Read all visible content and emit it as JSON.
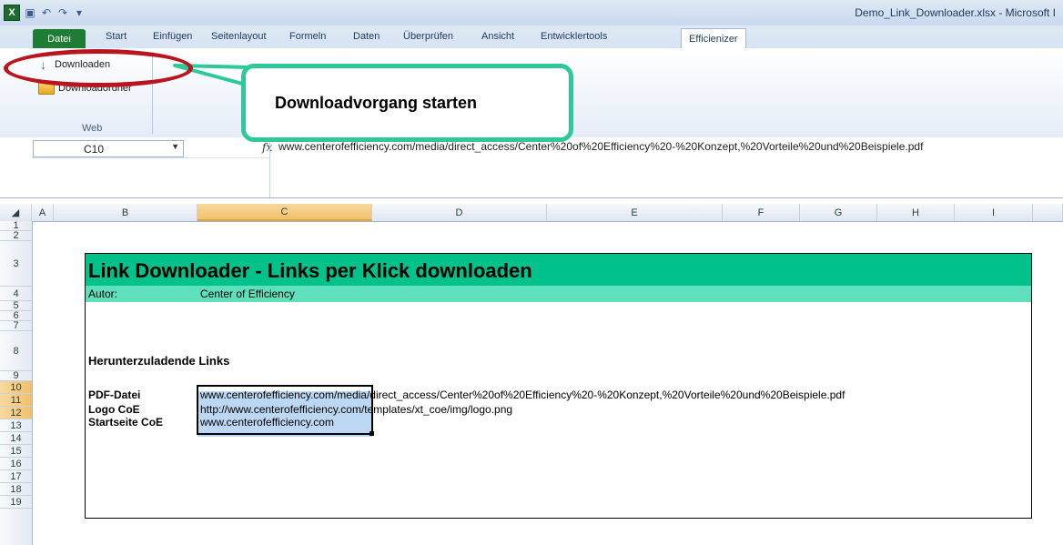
{
  "window": {
    "title": "Demo_Link_Downloader.xlsx - Microsoft I",
    "app_icon": "excel-icon",
    "quick_access": [
      "save-icon",
      "undo-icon",
      "redo-icon",
      "customize-icon"
    ]
  },
  "tabs": [
    {
      "label": "Datei"
    },
    {
      "label": "Start"
    },
    {
      "label": "Einfügen"
    },
    {
      "label": "Seitenlayout"
    },
    {
      "label": "Formeln"
    },
    {
      "label": "Daten"
    },
    {
      "label": "Überprüfen"
    },
    {
      "label": "Ansicht"
    },
    {
      "label": "Entwicklertools"
    },
    {
      "label": "Efficienizer"
    }
  ],
  "ribbon": {
    "downloaden_label": "Downloaden",
    "downloadordner_label": "Downloadordner",
    "group_label": "Web"
  },
  "callout": {
    "text": "Downloadvorgang starten"
  },
  "formula_bar": {
    "name_box": "C10",
    "fx": "fx",
    "formula": "www.centerofefficiency.com/media/direct_access/Center%20of%20Efficiency%20-%20Konzept,%20Vorteile%20und%20Beispiele.pdf"
  },
  "columns": [
    "A",
    "B",
    "C",
    "D",
    "E",
    "F",
    "G",
    "H",
    "I"
  ],
  "rows": [
    "1",
    "2",
    "3",
    "4",
    "5",
    "6",
    "7",
    "8",
    "9",
    "10",
    "11",
    "12",
    "13",
    "14",
    "15",
    "16",
    "17",
    "18",
    "19"
  ],
  "sheet": {
    "title": "Link Downloader - Links per Klick downloaden",
    "author_label": "Autor:",
    "author_value": "Center of Efficiency",
    "section_title": "Herunterzuladende Links",
    "links": [
      {
        "label": "PDF-Datei",
        "url": "www.centerofefficiency.com/media/direct_access/Center%20of%20Efficiency%20-%20Konzept,%20Vorteile%20und%20Beispiele.pdf"
      },
      {
        "label": "Logo CoE",
        "url": "http://www.centerofefficiency.com/templates/xt_coe/img/logo.png"
      },
      {
        "label": "Startseite CoE",
        "url": "www.centerofefficiency.com"
      }
    ]
  },
  "colors": {
    "title_band": "#00c28a",
    "author_band": "#5fe0bc",
    "annotation_ellipse": "#b8151e",
    "callout_border": "#2dc99a",
    "selection_fill": "#bcd7f2"
  }
}
